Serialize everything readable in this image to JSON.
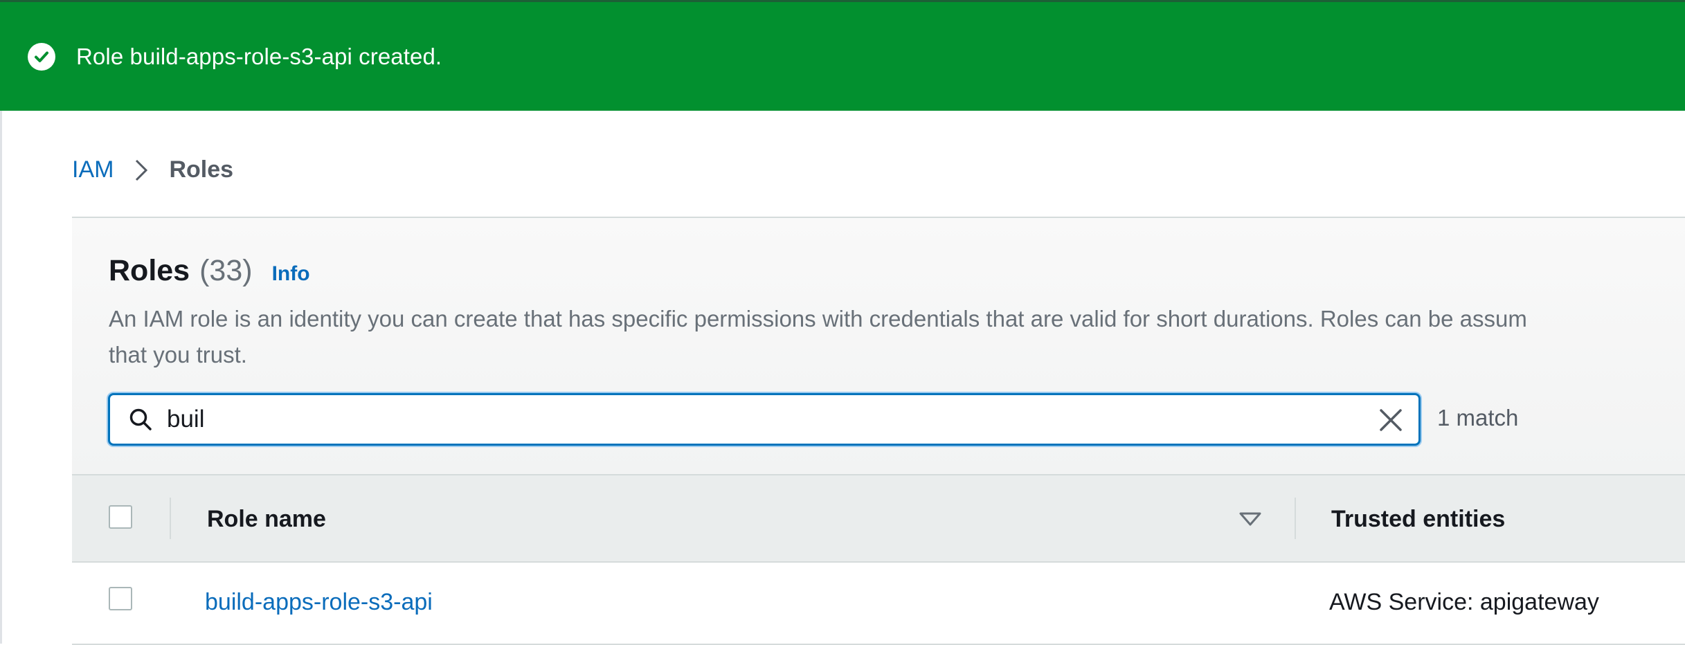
{
  "flash": {
    "message": "Role build-apps-role-s3-api created.",
    "icon": "check-circle-icon",
    "color": "#02902f"
  },
  "breadcrumb": {
    "root": "IAM",
    "current": "Roles"
  },
  "roles": {
    "title": "Roles",
    "count": "(33)",
    "info_label": "Info",
    "description_line1": "An IAM role is an identity you can create that has specific permissions with credentials that are valid for short durations. Roles can be assum",
    "description_line2": "that you trust.",
    "search": {
      "value": "buil",
      "placeholder": ""
    },
    "match_text": "1 match"
  },
  "table": {
    "columns": [
      "Role name",
      "Trusted entities"
    ],
    "rows": [
      {
        "role_name": "build-apps-role-s3-api",
        "trusted_entities": "AWS Service: apigateway"
      }
    ]
  },
  "colors": {
    "link": "#0a6cbb",
    "accent_focus": "#0073bb"
  }
}
